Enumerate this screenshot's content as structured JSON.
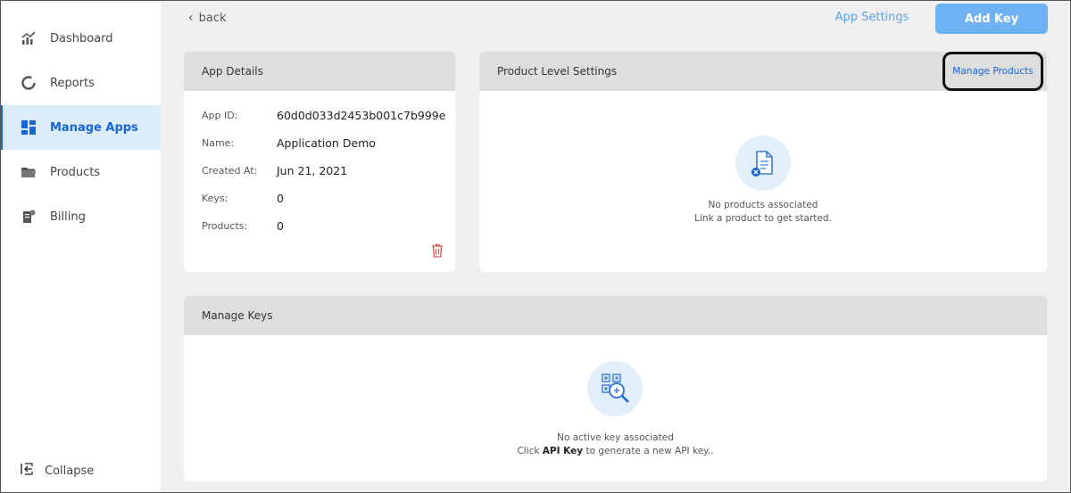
{
  "sidebar": {
    "items": [
      {
        "label": "Dashboard",
        "icon": "chart-icon"
      },
      {
        "label": "Reports",
        "icon": "donut-icon"
      },
      {
        "label": "Manage Apps",
        "icon": "grid-icon"
      },
      {
        "label": "Products",
        "icon": "folder-icon"
      },
      {
        "label": "Billing",
        "icon": "receipt-icon"
      }
    ],
    "collapse_label": "Collapse"
  },
  "topbar": {
    "back_label": "back",
    "app_settings_label": "App Settings",
    "add_key_label": "Add Key"
  },
  "app_details": {
    "title": "App Details",
    "rows": [
      {
        "label": "App ID:",
        "value": "60d0d033d2453b001c7b999e"
      },
      {
        "label": "Name:",
        "value": "Application Demo"
      },
      {
        "label": "Created At:",
        "value": "Jun 21, 2021"
      },
      {
        "label": "Keys:",
        "value": "0"
      },
      {
        "label": "Products:",
        "value": "0"
      }
    ]
  },
  "product_settings": {
    "title": "Product Level Settings",
    "manage_label": "Manage Products",
    "empty_line1": "No products associated",
    "empty_line2": "Link a product to get started."
  },
  "manage_keys": {
    "title": "Manage Keys",
    "empty_line1": "No active key associated",
    "empty_line2_prefix": "Click ",
    "empty_line2_bold": "API Key",
    "empty_line2_suffix": " to generate a new API key.."
  },
  "colors": {
    "accent": "#1565d8",
    "active_bg": "#dcecfb",
    "button_bg": "#6eb2f3",
    "danger": "#e05252"
  }
}
